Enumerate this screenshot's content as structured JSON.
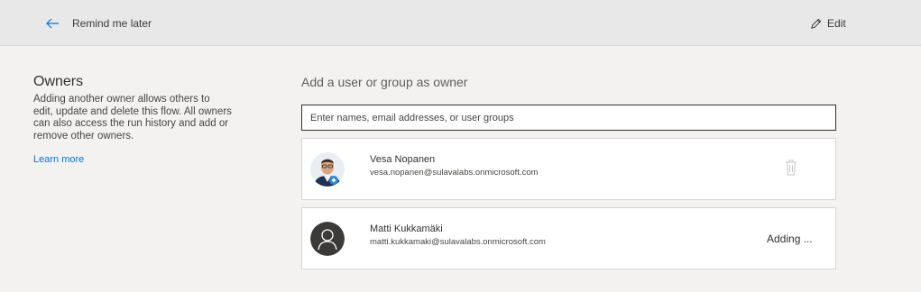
{
  "header": {
    "back_label": "Remind me later",
    "edit_label": "Edit"
  },
  "owners_panel": {
    "title": "Owners",
    "description": "Adding another owner allows others to edit, update and delete this flow. All owners can also access the run history and add or remove other owners.",
    "learn_more": "Learn more"
  },
  "add_owner": {
    "title": "Add a user or group as owner",
    "placeholder": "Enter names, email addresses, or user groups"
  },
  "owners": [
    {
      "name": "Vesa Nopanen",
      "email": "vesa.nopanen@sulavalabs.onmicrosoft.com",
      "action": "trash-icon"
    },
    {
      "name": "Matti Kukkamäki",
      "email": "matti.kukkamaki@sulavalabs.onmicrosoft.com",
      "status": "Adding ..."
    }
  ],
  "colors": {
    "link": "#0078d4",
    "topbar": "#e8e8e8",
    "background": "#f3f2f1",
    "default_avatar": "#3b3a39"
  }
}
